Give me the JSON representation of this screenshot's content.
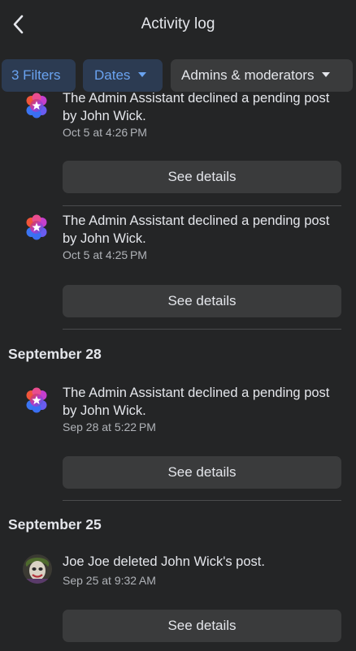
{
  "header": {
    "title": "Activity log"
  },
  "filters": {
    "filters_label": "3 Filters",
    "dates_label": "Dates",
    "admins_label": "Admins & moderators"
  },
  "entries": [
    {
      "text": "The Admin Assistant declined a pending post by John Wick.",
      "time": "Oct 5 at 4:26 PM",
      "button": "See details",
      "icon": "admin-assistant-icon"
    },
    {
      "text": "The Admin Assistant declined a pending post by John Wick.",
      "time": "Oct 5 at 4:25 PM",
      "button": "See details",
      "icon": "admin-assistant-icon"
    },
    {
      "text": "The Admin Assistant declined a pending post by John Wick.",
      "time": "Sep 28 at 5:22 PM",
      "button": "See details",
      "icon": "admin-assistant-icon"
    },
    {
      "text": "Joe Joe deleted John Wick's post.",
      "time": "Sep 25 at 9:32 AM",
      "button": "See details",
      "icon": "user-avatar"
    }
  ],
  "sections": {
    "sep28": "September 28",
    "sep25": "September 25"
  },
  "colors": {
    "background": "#242526",
    "chip_blue_bg": "#2c3b52",
    "chip_blue_text": "#6aa3f0",
    "button_bg": "#3a3b3c",
    "secondary_text": "#b0b3b8"
  }
}
